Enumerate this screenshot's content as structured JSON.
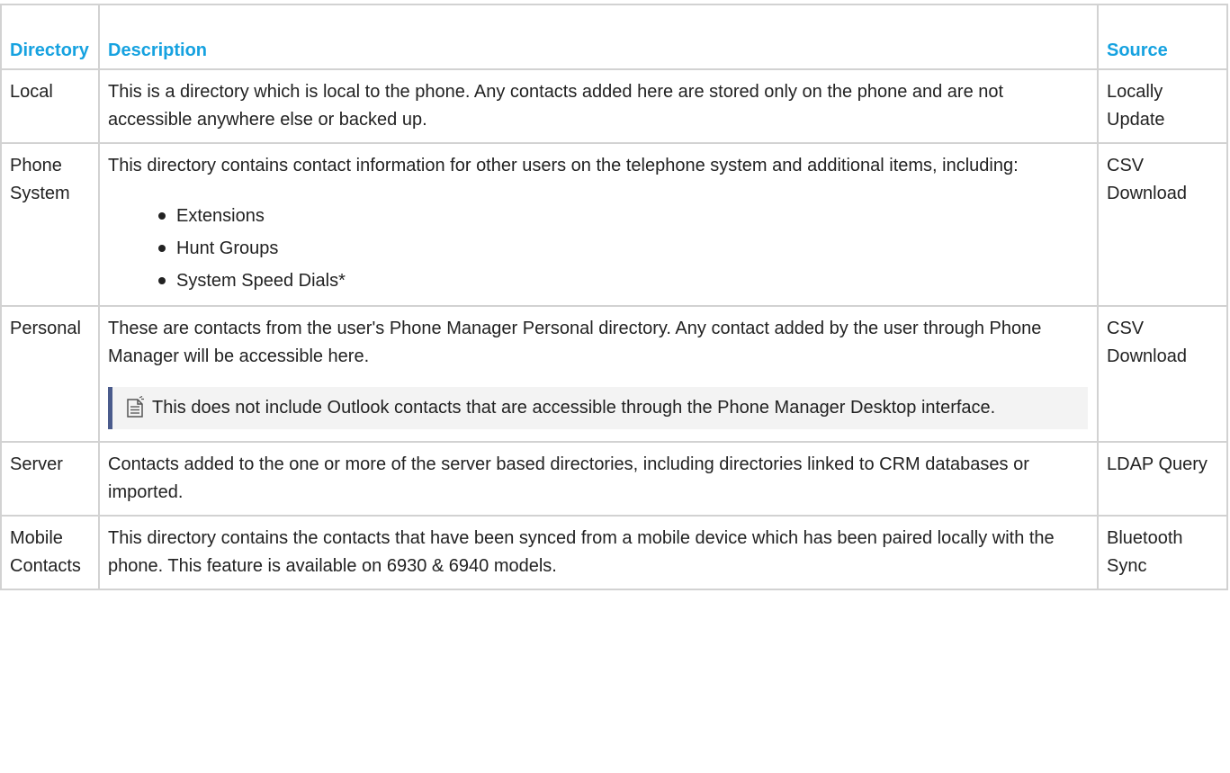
{
  "table": {
    "headers": {
      "directory": "Directory",
      "description": "Description",
      "source": "Source"
    },
    "rows": [
      {
        "directory": "Local",
        "description": "This is a directory which is local to the phone. Any contacts added here are stored only on the phone and are not accessible anywhere else or backed up.",
        "source": "Locally Update"
      },
      {
        "directory": "Phone System",
        "description": "This directory contains contact information for other users on the telephone system and additional items, including:",
        "items": [
          "Extensions",
          "Hunt Groups",
          "System Speed Dials*"
        ],
        "source": "CSV Download"
      },
      {
        "directory": "Personal",
        "description": "These are contacts from the user's Phone Manager Personal directory. Any contact added by the user through Phone Manager will be accessible here.",
        "note": "This does not include Outlook contacts that are accessible through the Phone Manager Desktop interface.",
        "source": "CSV Download"
      },
      {
        "directory": "Server",
        "description": "Contacts added to the one or more of the server based directories, including directories linked to CRM databases or imported.",
        "source": "LDAP Query"
      },
      {
        "directory": "Mobile Contacts",
        "description": "This directory contains the contacts that have been synced from a mobile device which has been paired locally with the phone. This feature is available on 6930 & 6940 models.",
        "source": "Bluetooth Sync"
      }
    ]
  },
  "colors": {
    "header_text": "#16a2e0",
    "border": "#d2d2d2",
    "note_bar": "#4a5b8c",
    "note_bg": "#f3f3f3"
  },
  "icons": {
    "note": "note-icon"
  }
}
